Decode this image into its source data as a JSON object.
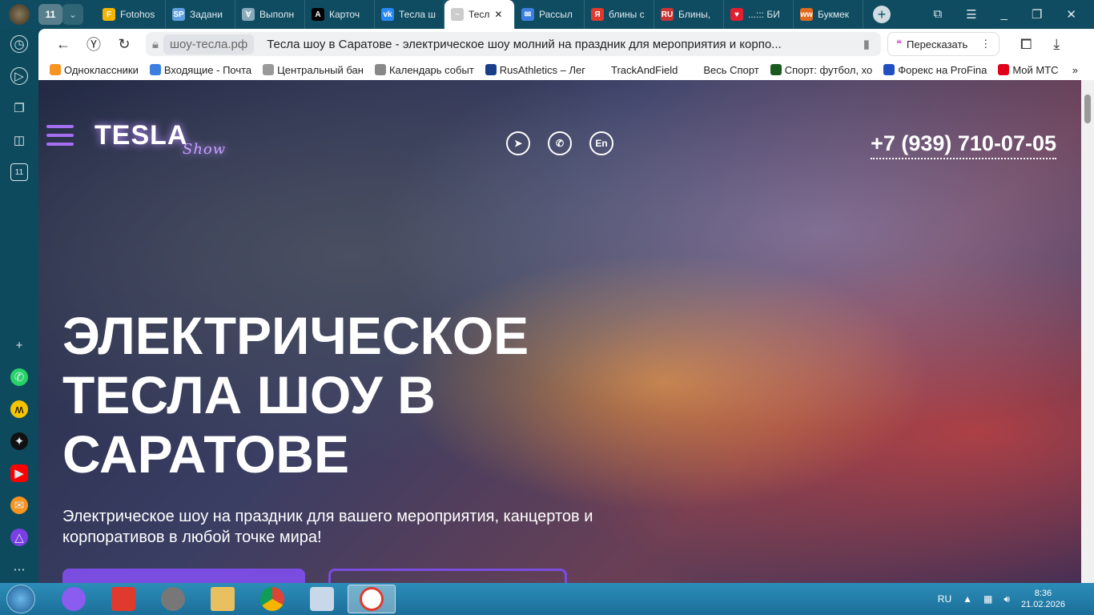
{
  "browser": {
    "tab_count": "11",
    "tabs": [
      {
        "label": "Fotohos",
        "icon": "F",
        "color": "#f5b400"
      },
      {
        "label": "Задани",
        "icon": "SP",
        "color": "#5fa0e0"
      },
      {
        "label": "Выполн",
        "icon": "∀",
        "color": "#8ab"
      },
      {
        "label": "Карточ",
        "icon": "A",
        "color": "#000"
      },
      {
        "label": "Тесла ш",
        "icon": "vk",
        "color": "#2787f5"
      },
      {
        "label": "Тесл",
        "icon": "~",
        "color": "#ccc",
        "active": true
      },
      {
        "label": "Рассыл",
        "icon": "✉",
        "color": "#3d7fe0"
      },
      {
        "label": "блины с",
        "icon": "Я",
        "color": "#e03a2f"
      },
      {
        "label": "Блины,",
        "icon": "RU",
        "color": "#c33"
      },
      {
        "label": "...::: БИ",
        "icon": "♥",
        "color": "#e02030"
      },
      {
        "label": "Букмек",
        "icon": "ww",
        "color": "#e06a20"
      }
    ],
    "url_domain": "шоу-тесла.рф",
    "page_title": "Тесла шоу в Саратове - электрическое шоу молний на праздник для мероприятия и корпо...",
    "retell_label": "Пересказать",
    "bookmarks": [
      {
        "label": "Одноклассники",
        "color": "#f7931e"
      },
      {
        "label": "Входящие - Почта",
        "color": "#3d7fe0"
      },
      {
        "label": "Центральный бан",
        "color": "#999"
      },
      {
        "label": "Календарь событ",
        "color": "#888"
      },
      {
        "label": "RusAthletics – Лег",
        "color": "#1a3f8a"
      },
      {
        "label": "TrackAndField",
        "color": "#fff"
      },
      {
        "label": "Весь Спорт",
        "color": "transparent"
      },
      {
        "label": "Спорт: футбол, хо",
        "color": "#1a5a20"
      },
      {
        "label": "Форекс на ProFina",
        "color": "#2050c0"
      },
      {
        "label": "Мой МТС",
        "color": "#e0001a"
      }
    ]
  },
  "site": {
    "logo_main": "TESLA",
    "logo_script": "Show",
    "social": [
      "telegram",
      "phone",
      "En"
    ],
    "phone": "+7 (939) 710-07-05",
    "headline": "ЭЛЕКТРИЧЕСКОЕ ТЕСЛА ШОУ В САРАТОВЕ",
    "subtitle": "Электрическое шоу на праздник для вашего мероприятия, канцертов и корпоративов в любой точке мира!",
    "accent": "#7a4de0"
  },
  "taskbar": {
    "lang": "RU",
    "time": "8:36",
    "date": "21.02.2026"
  }
}
